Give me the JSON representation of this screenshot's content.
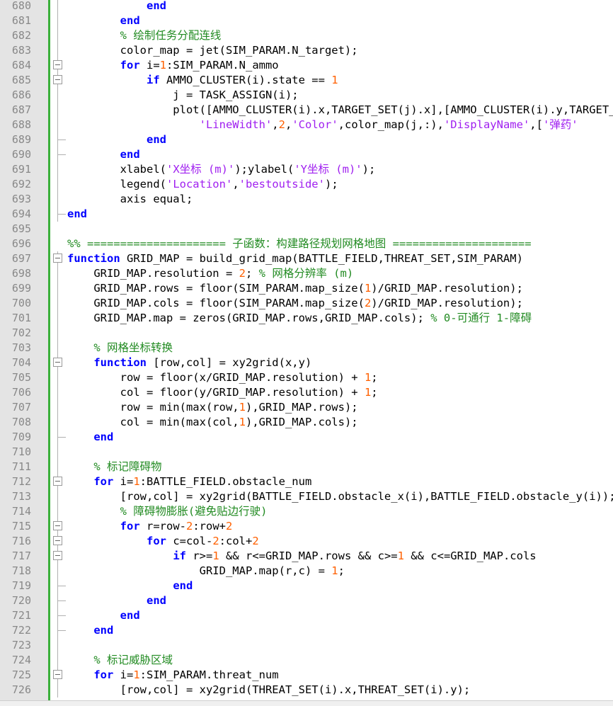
{
  "editor": {
    "language": "MATLAB",
    "lines": [
      {
        "n": "680",
        "segs": [
          [
            "            ",
            ""
          ],
          [
            "end",
            "kw"
          ]
        ]
      },
      {
        "n": "681",
        "segs": [
          [
            "        ",
            ""
          ],
          [
            "end",
            "kw"
          ]
        ]
      },
      {
        "n": "682",
        "segs": [
          [
            "        ",
            ""
          ],
          [
            "% 绘制任务分配连线",
            "cmt"
          ]
        ]
      },
      {
        "n": "683",
        "segs": [
          [
            "        color_map = jet(SIM_PARAM.N_target);",
            ""
          ]
        ]
      },
      {
        "n": "684",
        "segs": [
          [
            "        ",
            ""
          ],
          [
            "for",
            "kw"
          ],
          [
            " i=",
            ""
          ],
          [
            "1",
            "num"
          ],
          [
            ":SIM_PARAM.N_ammo",
            ""
          ]
        ]
      },
      {
        "n": "685",
        "segs": [
          [
            "            ",
            ""
          ],
          [
            "if",
            "kw"
          ],
          [
            " AMMO_CLUSTER(i).state == ",
            ""
          ],
          [
            "1",
            "num"
          ]
        ]
      },
      {
        "n": "686",
        "segs": [
          [
            "                j = TASK_ASSIGN(i);",
            ""
          ]
        ]
      },
      {
        "n": "687",
        "segs": [
          [
            "                plot([AMMO_CLUSTER(i).x,TARGET_SET(j).x],[AMMO_CLUSTER(i).y,TARGET_SET(j).y],...",
            ""
          ]
        ]
      },
      {
        "n": "688",
        "segs": [
          [
            "                    ",
            ""
          ],
          [
            "'LineWidth'",
            "str"
          ],
          [
            ",",
            ""
          ],
          [
            "2",
            "num"
          ],
          [
            ",",
            ""
          ],
          [
            "'Color'",
            "str"
          ],
          [
            ",color_map(j,:),",
            ""
          ],
          [
            "'DisplayName'",
            "str"
          ],
          [
            ",[",
            ""
          ],
          [
            "'弹药'",
            "str"
          ]
        ]
      },
      {
        "n": "689",
        "segs": [
          [
            "            ",
            ""
          ],
          [
            "end",
            "kw"
          ]
        ]
      },
      {
        "n": "690",
        "segs": [
          [
            "        ",
            ""
          ],
          [
            "end",
            "kw"
          ]
        ]
      },
      {
        "n": "691",
        "segs": [
          [
            "        xlabel(",
            ""
          ],
          [
            "'X坐标 (m)'",
            "str"
          ],
          [
            ");ylabel(",
            ""
          ],
          [
            "'Y坐标 (m)'",
            "str"
          ],
          [
            ");",
            ""
          ]
        ]
      },
      {
        "n": "692",
        "segs": [
          [
            "        legend(",
            ""
          ],
          [
            "'Location'",
            "str"
          ],
          [
            ",",
            ""
          ],
          [
            "'bestoutside'",
            "str"
          ],
          [
            ");",
            ""
          ]
        ]
      },
      {
        "n": "693",
        "segs": [
          [
            "        axis equal;",
            ""
          ]
        ]
      },
      {
        "n": "694",
        "segs": [
          [
            "",
            ""
          ],
          [
            "end",
            "kw"
          ]
        ]
      },
      {
        "n": "695",
        "segs": []
      },
      {
        "n": "696",
        "segs": [
          [
            "",
            ""
          ],
          [
            "%% ===================== 子函数：构建路径规划网格地图 =====================",
            "cmt"
          ]
        ]
      },
      {
        "n": "697",
        "segs": [
          [
            "",
            ""
          ],
          [
            "function",
            "kw"
          ],
          [
            " GRID_MAP = build_grid_map(BATTLE_FIELD,THREAT_SET,SIM_PARAM)",
            ""
          ]
        ]
      },
      {
        "n": "698",
        "segs": [
          [
            "    GRID_MAP.resolution = ",
            ""
          ],
          [
            "2",
            "num"
          ],
          [
            "; ",
            ""
          ],
          [
            "% 网格分辨率 (m)",
            "cmt"
          ]
        ]
      },
      {
        "n": "699",
        "segs": [
          [
            "    GRID_MAP.rows = floor(SIM_PARAM.map_size(",
            ""
          ],
          [
            "1",
            "num"
          ],
          [
            ")/GRID_MAP.resolution);",
            ""
          ]
        ]
      },
      {
        "n": "700",
        "segs": [
          [
            "    GRID_MAP.cols = floor(SIM_PARAM.map_size(",
            ""
          ],
          [
            "2",
            "num"
          ],
          [
            ")/GRID_MAP.resolution);",
            ""
          ]
        ]
      },
      {
        "n": "701",
        "segs": [
          [
            "    GRID_MAP.map = zeros(GRID_MAP.rows,GRID_MAP.cols); ",
            ""
          ],
          [
            "% 0-可通行 1-障碍",
            "cmt"
          ]
        ]
      },
      {
        "n": "702",
        "segs": []
      },
      {
        "n": "703",
        "segs": [
          [
            "    ",
            ""
          ],
          [
            "% 网格坐标转换",
            "cmt"
          ]
        ]
      },
      {
        "n": "704",
        "segs": [
          [
            "    ",
            ""
          ],
          [
            "function",
            "kw"
          ],
          [
            " [row,col] = xy2grid(x,y)",
            ""
          ]
        ]
      },
      {
        "n": "705",
        "segs": [
          [
            "        row = floor(x/GRID_MAP.resolution) + ",
            ""
          ],
          [
            "1",
            "num"
          ],
          [
            ";",
            ""
          ]
        ]
      },
      {
        "n": "706",
        "segs": [
          [
            "        col = floor(y/GRID_MAP.resolution) + ",
            ""
          ],
          [
            "1",
            "num"
          ],
          [
            ";",
            ""
          ]
        ]
      },
      {
        "n": "707",
        "segs": [
          [
            "        row = min(max(row,",
            ""
          ],
          [
            "1",
            "num"
          ],
          [
            "),GRID_MAP.rows);",
            ""
          ]
        ]
      },
      {
        "n": "708",
        "segs": [
          [
            "        col = min(max(col,",
            ""
          ],
          [
            "1",
            "num"
          ],
          [
            "),GRID_MAP.cols);",
            ""
          ]
        ]
      },
      {
        "n": "709",
        "segs": [
          [
            "    ",
            ""
          ],
          [
            "end",
            "kw"
          ]
        ]
      },
      {
        "n": "710",
        "segs": []
      },
      {
        "n": "711",
        "segs": [
          [
            "    ",
            ""
          ],
          [
            "% 标记障碍物",
            "cmt"
          ]
        ]
      },
      {
        "n": "712",
        "segs": [
          [
            "    ",
            ""
          ],
          [
            "for",
            "kw"
          ],
          [
            " i=",
            ""
          ],
          [
            "1",
            "num"
          ],
          [
            ":BATTLE_FIELD.obstacle_num",
            ""
          ]
        ]
      },
      {
        "n": "713",
        "segs": [
          [
            "        [row,col] = xy2grid(BATTLE_FIELD.obstacle_x(i),BATTLE_FIELD.obstacle_y(i));",
            ""
          ]
        ]
      },
      {
        "n": "714",
        "segs": [
          [
            "        ",
            ""
          ],
          [
            "% 障碍物膨胀(避免贴边行驶)",
            "cmt"
          ]
        ]
      },
      {
        "n": "715",
        "segs": [
          [
            "        ",
            ""
          ],
          [
            "for",
            "kw"
          ],
          [
            " r=row-",
            ""
          ],
          [
            "2",
            "num"
          ],
          [
            ":row+",
            ""
          ],
          [
            "2",
            "num"
          ]
        ]
      },
      {
        "n": "716",
        "segs": [
          [
            "            ",
            ""
          ],
          [
            "for",
            "kw"
          ],
          [
            " c=col-",
            ""
          ],
          [
            "2",
            "num"
          ],
          [
            ":col+",
            ""
          ],
          [
            "2",
            "num"
          ]
        ]
      },
      {
        "n": "717",
        "segs": [
          [
            "                ",
            ""
          ],
          [
            "if",
            "kw"
          ],
          [
            " r>=",
            ""
          ],
          [
            "1",
            "num"
          ],
          [
            " && r<=GRID_MAP.rows && c>=",
            ""
          ],
          [
            "1",
            "num"
          ],
          [
            " && c<=GRID_MAP.cols",
            ""
          ]
        ]
      },
      {
        "n": "718",
        "segs": [
          [
            "                    GRID_MAP.map(r,c) = ",
            ""
          ],
          [
            "1",
            "num"
          ],
          [
            ";",
            ""
          ]
        ]
      },
      {
        "n": "719",
        "segs": [
          [
            "                ",
            ""
          ],
          [
            "end",
            "kw"
          ]
        ]
      },
      {
        "n": "720",
        "segs": [
          [
            "            ",
            ""
          ],
          [
            "end",
            "kw"
          ]
        ]
      },
      {
        "n": "721",
        "segs": [
          [
            "        ",
            ""
          ],
          [
            "end",
            "kw"
          ]
        ]
      },
      {
        "n": "722",
        "segs": [
          [
            "    ",
            ""
          ],
          [
            "end",
            "kw"
          ]
        ]
      },
      {
        "n": "723",
        "segs": []
      },
      {
        "n": "724",
        "segs": [
          [
            "    ",
            ""
          ],
          [
            "% 标记威胁区域",
            "cmt"
          ]
        ]
      },
      {
        "n": "725",
        "segs": [
          [
            "    ",
            ""
          ],
          [
            "for",
            "kw"
          ],
          [
            " i=",
            ""
          ],
          [
            "1",
            "num"
          ],
          [
            ":SIM_PARAM.threat_num",
            ""
          ]
        ]
      },
      {
        "n": "726",
        "segs": [
          [
            "        [row,col] = xy2grid(THREAT_SET(i).x,THREAT_SET(i).y);",
            ""
          ]
        ]
      }
    ]
  }
}
